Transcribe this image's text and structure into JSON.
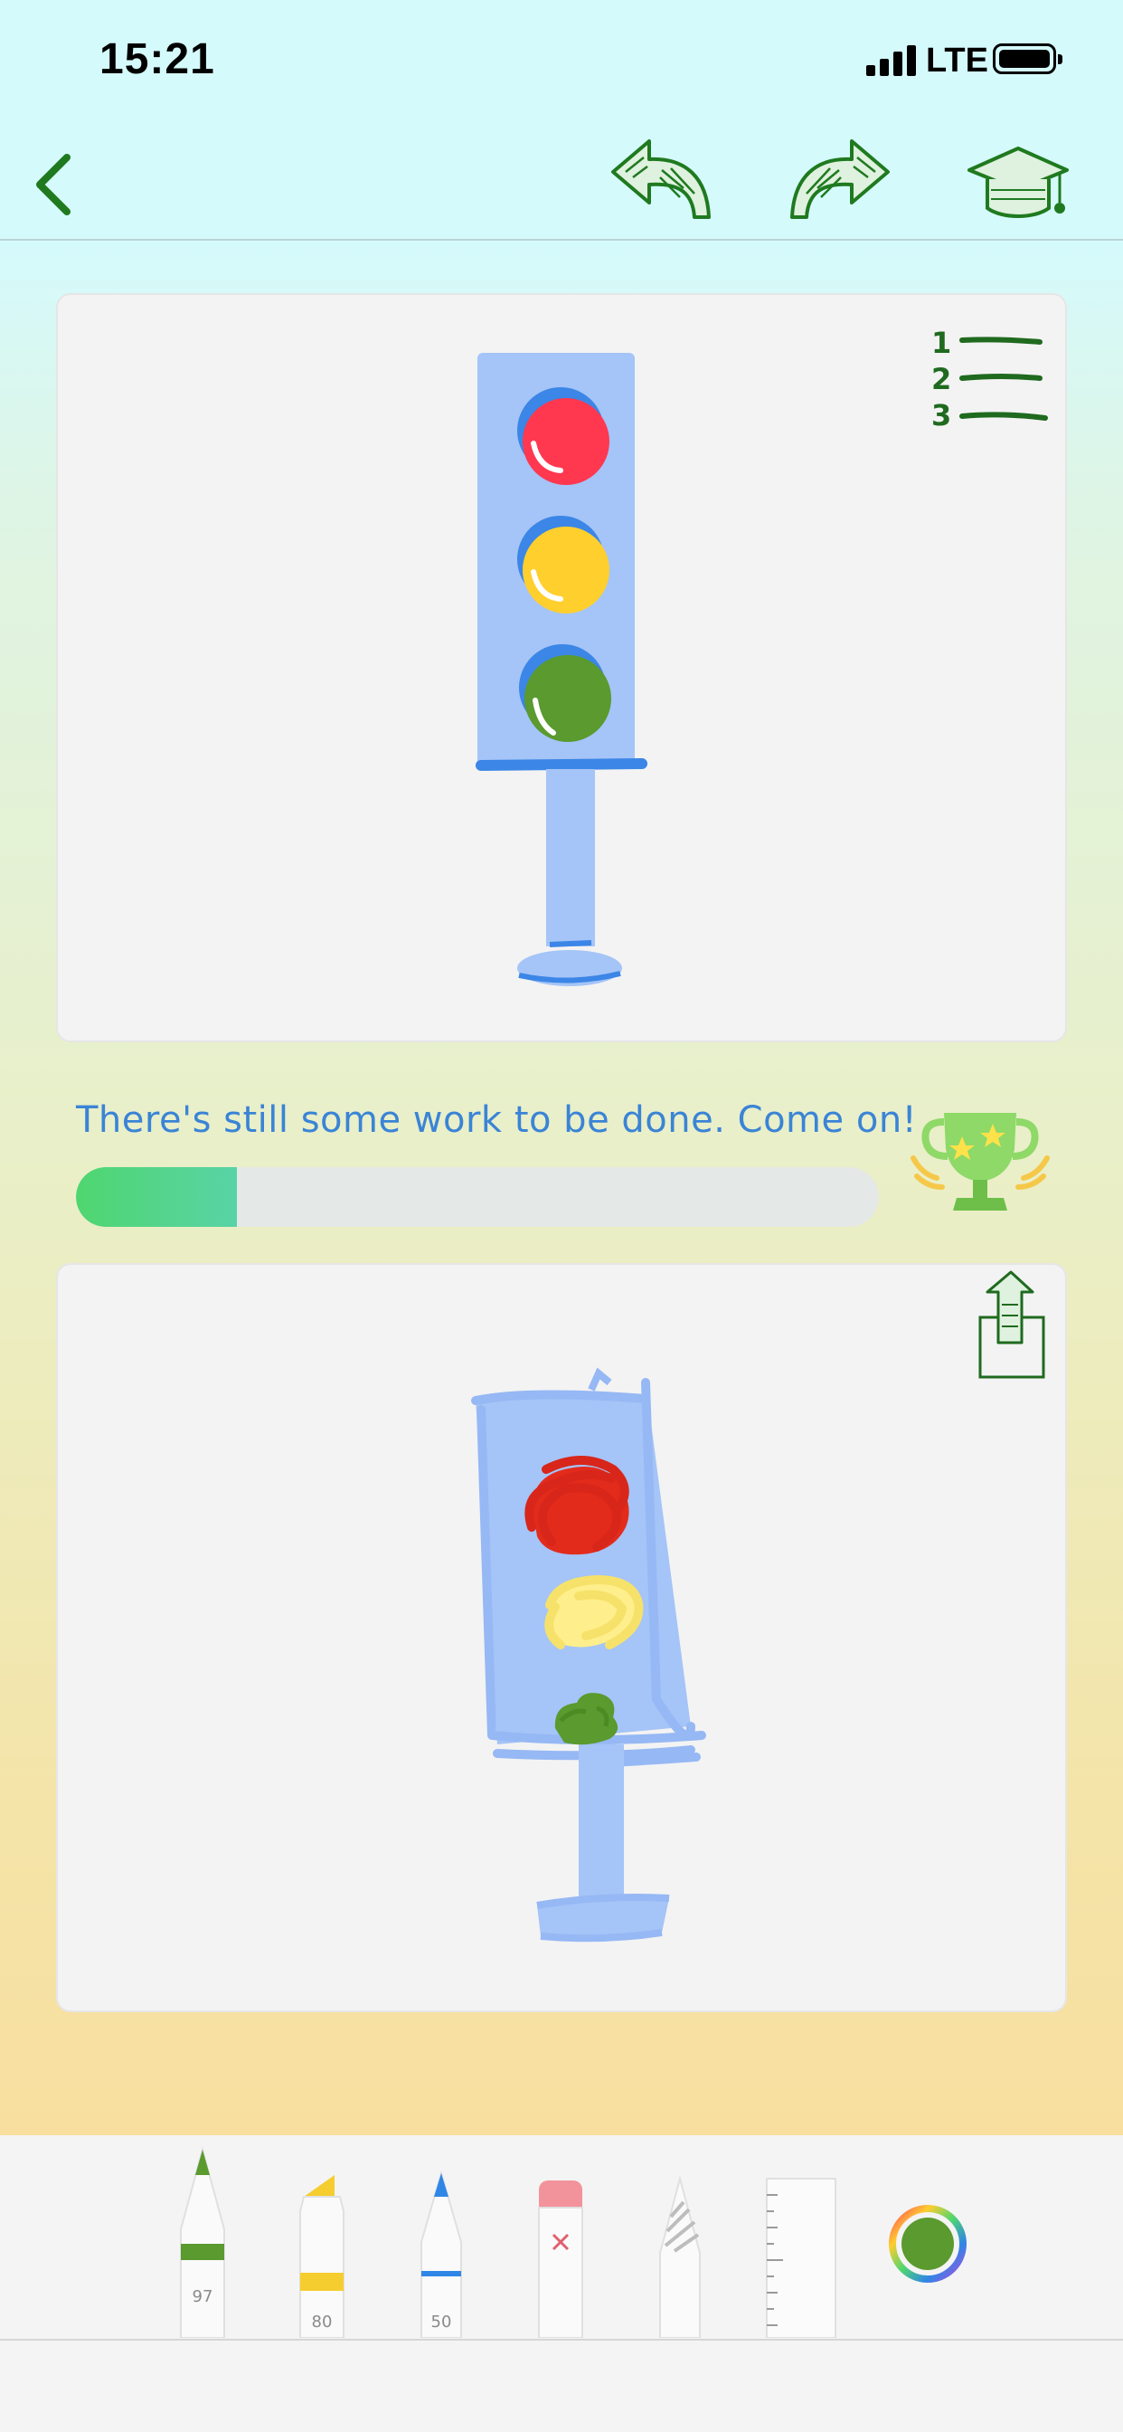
{
  "status": {
    "time": "15:21",
    "network": "LTE"
  },
  "nav": {
    "back": "chevron-left-icon",
    "undo": "undo-arrow-icon",
    "redo": "redo-arrow-icon",
    "lessons": "graduation-cap-icon"
  },
  "reference": {
    "steps_icon": "numbered-list-icon"
  },
  "feedback": {
    "message": "There's still some work to be done. Come on!",
    "progress": 0.2,
    "trophy": "trophy-icon"
  },
  "drawing": {
    "share_icon": "share-icon"
  },
  "tools": [
    {
      "name": "pencil",
      "label": "97"
    },
    {
      "name": "marker",
      "label": "80"
    },
    {
      "name": "pen",
      "label": "50"
    },
    {
      "name": "eraser"
    },
    {
      "name": "lasso"
    },
    {
      "name": "ruler"
    },
    {
      "name": "color-picker",
      "color": "#5a9a2e"
    }
  ]
}
